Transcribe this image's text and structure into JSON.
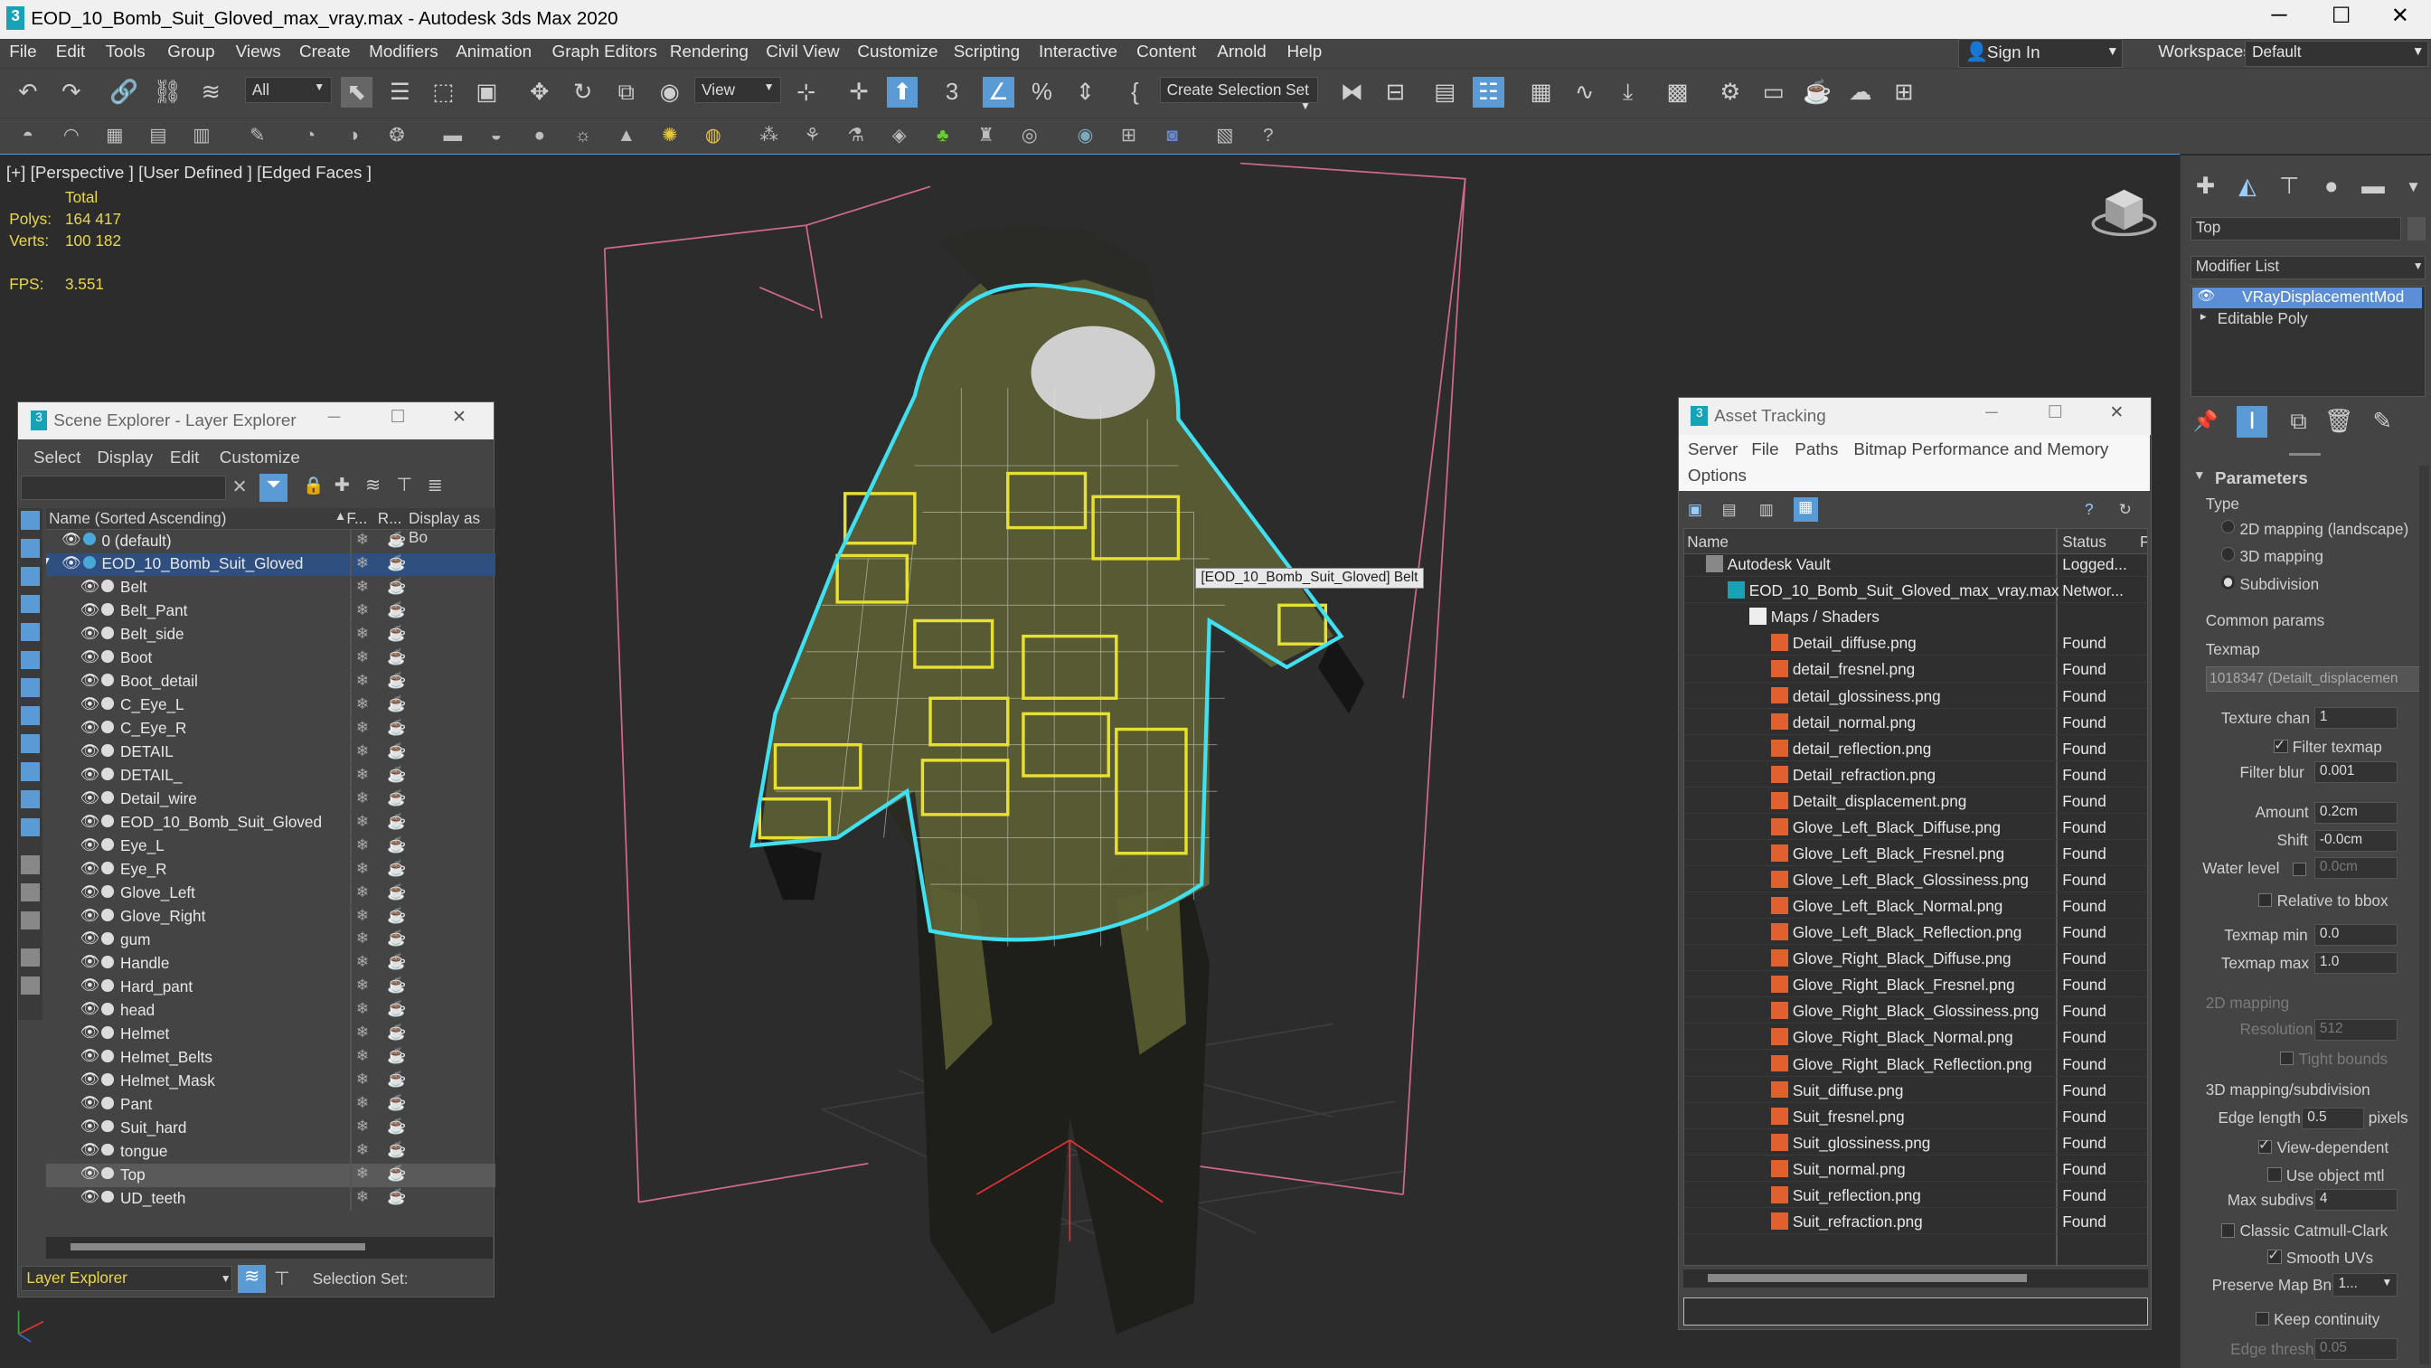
{
  "window": {
    "title": "EOD_10_Bomb_Suit_Gloved_max_vray.max - Autodesk 3ds Max 2020",
    "min": "─",
    "max": "☐",
    "close": "✕"
  },
  "menu": [
    "File",
    "Edit",
    "Tools",
    "Group",
    "Views",
    "Create",
    "Modifiers",
    "Animation",
    "Graph Editors",
    "Rendering",
    "Civil View",
    "Customize",
    "Scripting",
    "Interactive",
    "Content",
    "Arnold",
    "Help"
  ],
  "signin": "Sign In",
  "workspaces_label": "Workspaces:",
  "workspace": "Default",
  "toolbar": {
    "filter": "All",
    "refcoord": "View",
    "selset": "Create Selection Set"
  },
  "viewport": {
    "label": "[+] [Perspective ] [User Defined ] [Edged Faces ]",
    "total": "Total",
    "polys_label": "Polys:",
    "polys": "164 417",
    "verts_label": "Verts:",
    "verts": "100 182",
    "fps_label": "FPS:",
    "fps": "3.551",
    "tooltip": "[EOD_10_Bomb_Suit_Gloved] Belt"
  },
  "scene_explorer": {
    "title": "Scene Explorer - Layer Explorer",
    "menu": [
      "Select",
      "Display",
      "Edit",
      "Customize"
    ],
    "col_name": "Name (Sorted Ascending)",
    "col_f": "F...",
    "col_r": "R...",
    "col_d": "Display as Bo",
    "layer0": "0 (default)",
    "layer1": "EOD_10_Bomb_Suit_Gloved",
    "items": [
      "Belt",
      "Belt_Pant",
      "Belt_side",
      "Boot",
      "Boot_detail",
      "C_Eye_L",
      "C_Eye_R",
      "DETAIL",
      "DETAIL_",
      "Detail_wire",
      "EOD_10_Bomb_Suit_Gloved",
      "Eye_L",
      "Eye_R",
      "Glove_Left",
      "Glove_Right",
      "gum",
      "Handle",
      "Hard_pant",
      "head",
      "Helmet",
      "Helmet_Belts",
      "Helmet_Mask",
      "Pant",
      "Suit_hard",
      "tongue",
      "Top",
      "UD_teeth"
    ],
    "footer_mode": "Layer Explorer",
    "selection_set": "Selection Set:"
  },
  "asset_tracking": {
    "title": "Asset Tracking",
    "menu": [
      "Server",
      "File",
      "Paths",
      "Bitmap Performance and Memory",
      "Options"
    ],
    "col_name": "Name",
    "col_status": "Status",
    "col_p": "P",
    "vault": "Autodesk Vault",
    "vault_status": "Logged...",
    "file": "EOD_10_Bomb_Suit_Gloved_max_vray.max",
    "file_status": "Networ...",
    "maps": "Maps / Shaders",
    "files": [
      "Detail_diffuse.png",
      "detail_fresnel.png",
      "detail_glossiness.png",
      "detail_normal.png",
      "detail_reflection.png",
      "Detail_refraction.png",
      "Detailt_displacement.png",
      "Glove_Left_Black_Diffuse.png",
      "Glove_Left_Black_Fresnel.png",
      "Glove_Left_Black_Glossiness.png",
      "Glove_Left_Black_Normal.png",
      "Glove_Left_Black_Reflection.png",
      "Glove_Right_Black_Diffuse.png",
      "Glove_Right_Black_Fresnel.png",
      "Glove_Right_Black_Glossiness.png",
      "Glove_Right_Black_Normal.png",
      "Glove_Right_Black_Reflection.png",
      "Suit_diffuse.png",
      "Suit_fresnel.png",
      "Suit_glossiness.png",
      "Suit_normal.png",
      "Suit_reflection.png",
      "Suit_refraction.png"
    ],
    "found": "Found"
  },
  "command_panel": {
    "object_name": "Top",
    "modifier_list": "Modifier List",
    "modifiers": [
      "VRayDisplacementMod",
      "Editable Poly"
    ],
    "parameters": "Parameters",
    "type": "Type",
    "type_opts": [
      "2D mapping (landscape)",
      "3D mapping",
      "Subdivision"
    ],
    "common": "Common params",
    "texmap": "Texmap",
    "texmap_val": "1018347 (Detailt_displacemen",
    "texture_chan": "Texture chan",
    "texture_chan_val": "1",
    "filter_texmap": "Filter texmap",
    "filter_blur": "Filter blur",
    "filter_blur_val": "0.001",
    "amount": "Amount",
    "amount_val": "0.2cm",
    "shift": "Shift",
    "shift_val": "-0.0cm",
    "water": "Water level",
    "water_val": "0.0cm",
    "relative": "Relative to bbox",
    "texmap_min": "Texmap min",
    "texmap_min_val": "0.0",
    "texmap_max": "Texmap max",
    "texmap_max_val": "1.0",
    "map2d": "2D mapping",
    "resolution": "Resolution",
    "resolution_val": "512",
    "tight": "Tight bounds",
    "map3d": "3D mapping/subdivision",
    "edge": "Edge length",
    "edge_val": "0.5",
    "pixels": "pixels",
    "view_dep": "View-dependent",
    "use_obj": "Use object mtl",
    "max_subdivs": "Max subdivs",
    "max_subdivs_val": "4",
    "catmull": "Classic Catmull-Clark",
    "smooth": "Smooth UVs",
    "preserve": "Preserve Map Bnd",
    "preserve_val": "1...",
    "keep": "Keep continuity",
    "edge_thresh": "Edge thresh",
    "edge_thresh_val": "0.05"
  },
  "colors": {
    "accent": "#5b9bd5",
    "selection": "#1e90ff",
    "yellow": "#e8d84a",
    "cyan": "#40e0f0"
  }
}
